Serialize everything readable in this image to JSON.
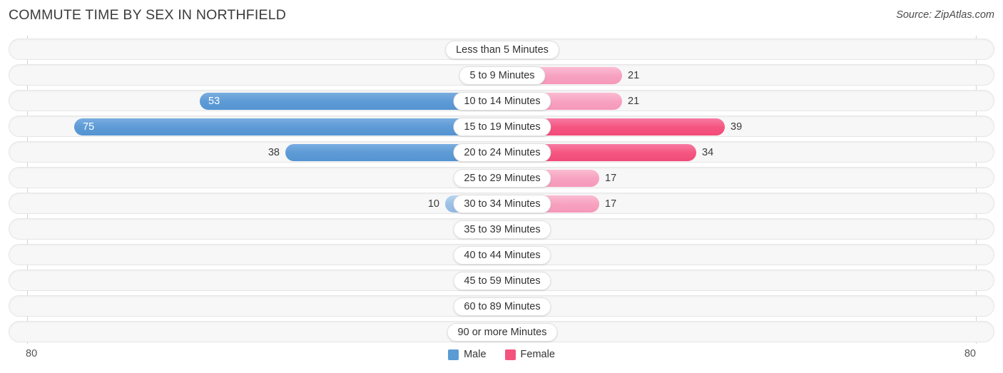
{
  "header": {
    "title": "COMMUTE TIME BY SEX IN NORTHFIELD",
    "source": "Source: ZipAtlas.com"
  },
  "legend": {
    "male_label": "Male",
    "female_label": "Female",
    "male_color": "#5b9bd5",
    "female_color": "#f4537e"
  },
  "axis": {
    "left_end_label": "80",
    "right_end_label": "80",
    "max": 80
  },
  "chart_data": {
    "type": "bar",
    "title": "COMMUTE TIME BY SEX IN NORTHFIELD",
    "subtitle": "",
    "orientation": "horizontal-diverging",
    "xlabel": "",
    "ylabel": "",
    "xlim": [
      80,
      80
    ],
    "grid": false,
    "legend_position": "bottom-center",
    "categories": [
      "Less than 5 Minutes",
      "5 to 9 Minutes",
      "10 to 14 Minutes",
      "15 to 19 Minutes",
      "20 to 24 Minutes",
      "25 to 29 Minutes",
      "30 to 34 Minutes",
      "35 to 39 Minutes",
      "40 to 44 Minutes",
      "45 to 59 Minutes",
      "60 to 89 Minutes",
      "90 or more Minutes"
    ],
    "series": [
      {
        "name": "Male",
        "side": "left",
        "values": [
          0,
          1,
          53,
          75,
          38,
          4,
          10,
          0,
          2,
          0,
          3,
          0
        ]
      },
      {
        "name": "Female",
        "side": "right",
        "values": [
          0,
          21,
          21,
          39,
          34,
          17,
          17,
          4,
          0,
          3,
          0,
          0
        ]
      }
    ]
  },
  "rows": [
    {
      "label": "Less than 5 Minutes",
      "male": "0",
      "female": "0"
    },
    {
      "label": "5 to 9 Minutes",
      "male": "1",
      "female": "21"
    },
    {
      "label": "10 to 14 Minutes",
      "male": "53",
      "female": "21"
    },
    {
      "label": "15 to 19 Minutes",
      "male": "75",
      "female": "39"
    },
    {
      "label": "20 to 24 Minutes",
      "male": "38",
      "female": "34"
    },
    {
      "label": "25 to 29 Minutes",
      "male": "4",
      "female": "17"
    },
    {
      "label": "30 to 34 Minutes",
      "male": "10",
      "female": "17"
    },
    {
      "label": "35 to 39 Minutes",
      "male": "0",
      "female": "4"
    },
    {
      "label": "40 to 44 Minutes",
      "male": "2",
      "female": "0"
    },
    {
      "label": "45 to 59 Minutes",
      "male": "0",
      "female": "3"
    },
    {
      "label": "60 to 89 Minutes",
      "male": "3",
      "female": "0"
    },
    {
      "label": "90 or more Minutes",
      "male": "0",
      "female": "0"
    }
  ]
}
